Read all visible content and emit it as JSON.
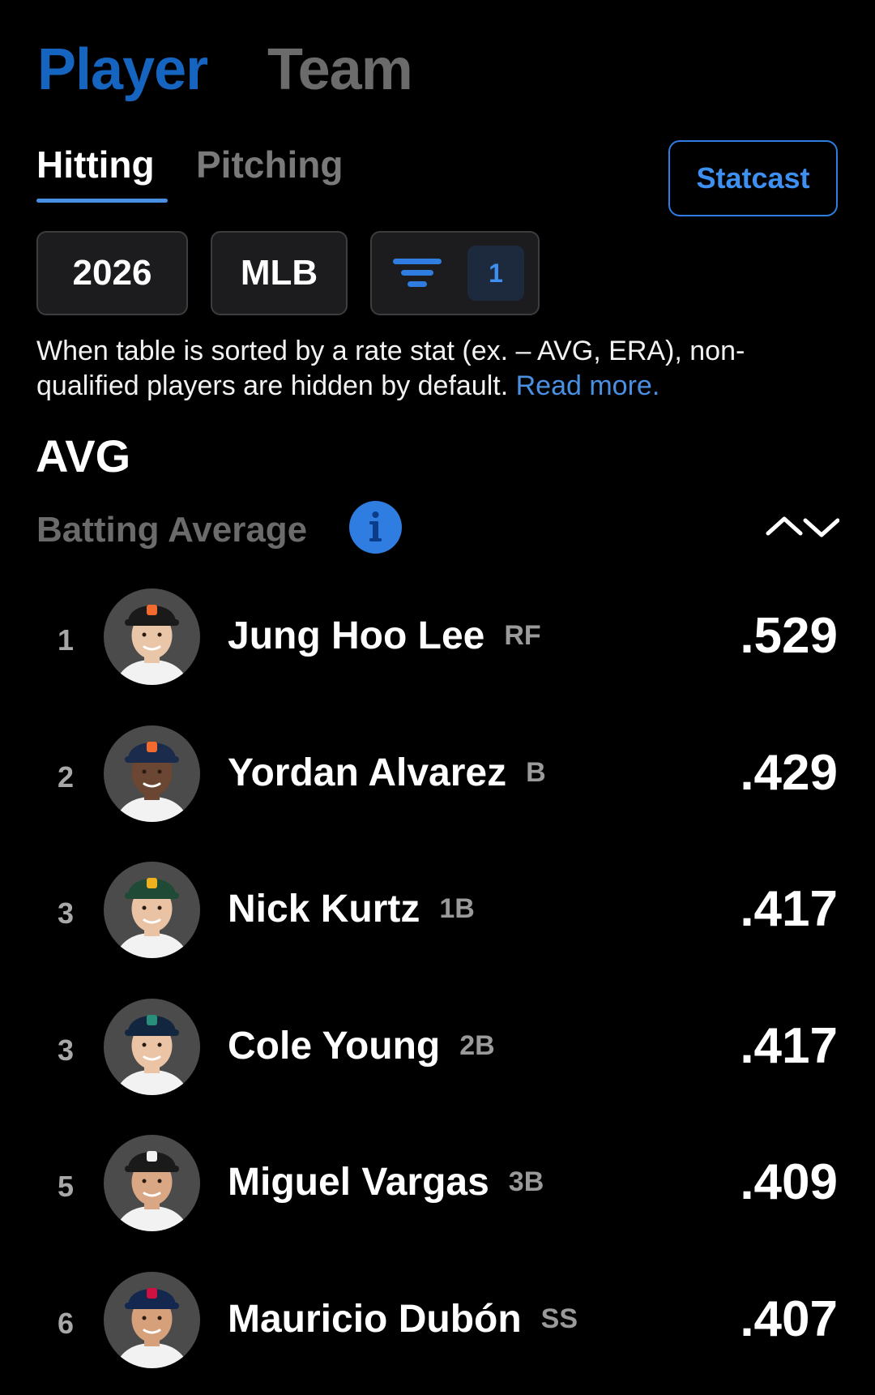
{
  "header": {
    "tabs": [
      "Player",
      "Team"
    ],
    "active_tab": "Player"
  },
  "subtabs": {
    "items": [
      "Hitting",
      "Pitching"
    ],
    "active": "Hitting"
  },
  "statcast_label": "Statcast",
  "filters": {
    "year": "2026",
    "league": "MLB",
    "filter_icon": "filter-icon",
    "filter_count": "1"
  },
  "notice": {
    "text": "When table is sorted by a rate stat (ex. – AVG, ERA), non-qualified players are hidden by default.",
    "link": "Read more."
  },
  "stat": {
    "abbr": "AVG",
    "name": "Batting Average",
    "info_icon": "info-icon",
    "sort_icon": "sort-toggle-icon"
  },
  "colors": {
    "accent": "#2f7de1",
    "inactive": "#6b6b6b",
    "background": "#000000"
  },
  "players": [
    {
      "rank": "1",
      "name": "Jung Hoo Lee",
      "pos": "RF",
      "value": ".529",
      "cap": "#1a1a1a",
      "logo": "#f26a2e",
      "skin": "#e9c6a8",
      "jersey": "#f2f2f2"
    },
    {
      "rank": "2",
      "name": "Yordan Alvarez",
      "pos": "B",
      "value": ".429",
      "cap": "#1b2b4b",
      "logo": "#f26a2e",
      "skin": "#6b4632",
      "jersey": "#f2f2f2"
    },
    {
      "rank": "3",
      "name": "Nick Kurtz",
      "pos": "1B",
      "value": ".417",
      "cap": "#1f4a35",
      "logo": "#efb21e",
      "skin": "#eac3a4",
      "jersey": "#f2f2f2"
    },
    {
      "rank": "3",
      "name": "Cole Young",
      "pos": "2B",
      "value": ".417",
      "cap": "#12263f",
      "logo": "#2a8f7a",
      "skin": "#ebc4a6",
      "jersey": "#f2f2f2"
    },
    {
      "rank": "5",
      "name": "Miguel Vargas",
      "pos": "3B",
      "value": ".409",
      "cap": "#1a1a1a",
      "logo": "#f2f2f2",
      "skin": "#d9a784",
      "jersey": "#f2f2f2"
    },
    {
      "rank": "6",
      "name": "Mauricio Dubón",
      "pos": "SS",
      "value": ".407",
      "cap": "#13274f",
      "logo": "#ce1141",
      "skin": "#d6a07a",
      "jersey": "#f2f2f2"
    }
  ]
}
